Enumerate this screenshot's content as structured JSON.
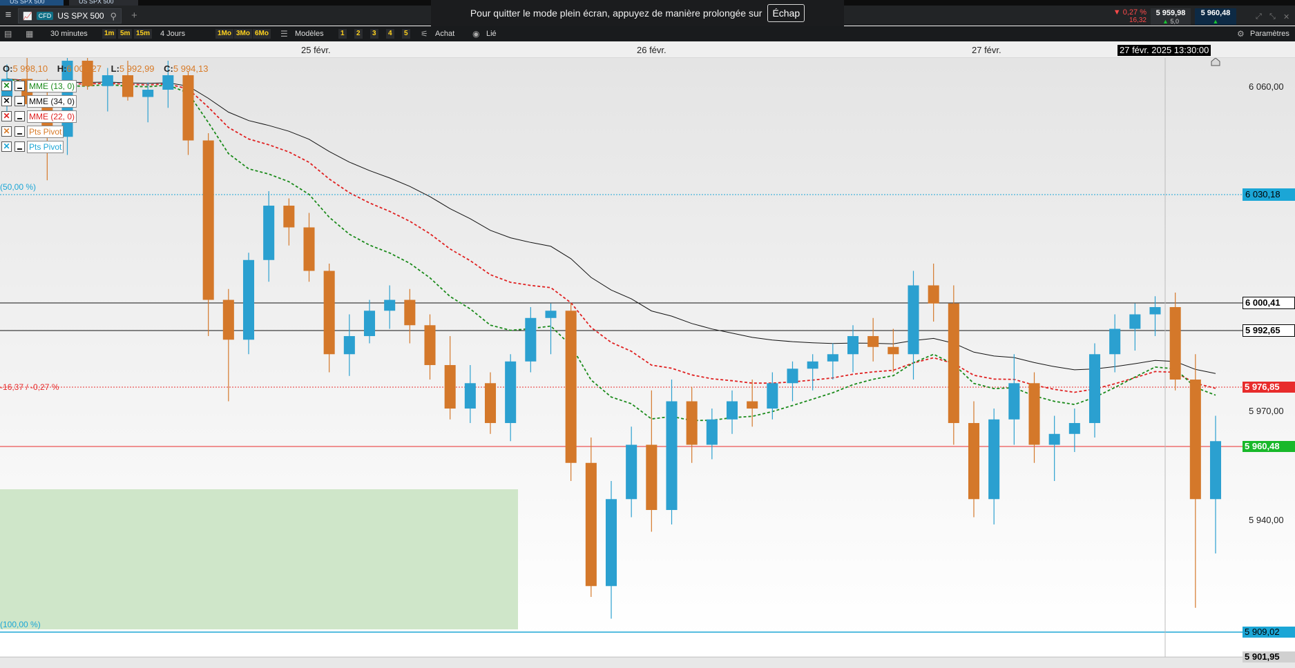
{
  "tabs": [
    "US SPX 500",
    "US SPX 500"
  ],
  "instrument": {
    "badge": "CFD",
    "name": "US SPX 500"
  },
  "fullscreen_notice": {
    "text": "Pour quitter le mode plein écran, appuyez de manière prolongée sur",
    "key": "Échap"
  },
  "quote": {
    "change_pct": "▼ 0,27 %",
    "change_abs": "16,32",
    "bid": "5 959,98",
    "ask": "5 960,48",
    "spread_marker": "▲",
    "spread": "5,0",
    "ask_marker": "▲"
  },
  "toolbar": {
    "timeframe": "30 minutes",
    "quick_intervals": [
      "1m",
      "5m",
      "15m"
    ],
    "period": "4 Jours",
    "quick_periods": [
      "1Mo",
      "3Mo",
      "6Mo"
    ],
    "templates": "Modèles",
    "layouts": [
      "1",
      "2",
      "3",
      "4",
      "5"
    ],
    "buy": "Achat",
    "linked": "Lié",
    "settings": "Paramètres"
  },
  "dates": [
    "25 févr.",
    "26 févr.",
    "27 févr."
  ],
  "crosshair_time": "27 févr. 2025 13:30:00",
  "ohlc": {
    "o_label": "O:",
    "o": "5 998,10",
    "h_label": "H:",
    "h": "6 002,27",
    "l_label": "L:",
    "l": "5 992,99",
    "c_label": "C:",
    "c": "5 994,13"
  },
  "indicators": [
    {
      "label": "MME (13, 0)",
      "color": "#1a8a1a"
    },
    {
      "label": "MME (34, 0)",
      "color": "#111111"
    },
    {
      "label": "MME (22, 0)",
      "color": "#e02020"
    },
    {
      "label": "Pts Pivot",
      "color": "#d87b28"
    },
    {
      "label": "Pts Pivot",
      "color": "#1ba6d6"
    }
  ],
  "fibo_levels": [
    "(50,00 %)",
    "(100,00 %)"
  ],
  "change_line_label": "-16,37 / -0,27 %",
  "price_axis": {
    "ticks": [
      "6 060,00",
      "5 970,00",
      "5 940,00"
    ],
    "markers": [
      {
        "value": "6 030,18",
        "bg": "#1ba6d6",
        "fg": "#000000"
      },
      {
        "value": "6 000,41",
        "bg": "#ffffff",
        "fg": "#000000"
      },
      {
        "value": "5 992,65",
        "bg": "#ffffff",
        "fg": "#000000"
      },
      {
        "value": "5 976,85",
        "bg": "#e82c2c",
        "fg": "#ffffff"
      },
      {
        "value": "5 960,48",
        "bg": "#18b82a",
        "fg": "#ffffff"
      },
      {
        "value": "5 909,02",
        "bg": "#1ba6d6",
        "fg": "#000000"
      },
      {
        "value": "5 901,95",
        "bg": "#d0d0d0",
        "fg": "#000000"
      }
    ]
  },
  "colors": {
    "up": "#2ba0d0",
    "down": "#d4782a",
    "ema13": "#1a8a1a",
    "ema34": "#111111",
    "ema22": "#e02020",
    "zone": "#cfe6c9"
  },
  "chart_data": {
    "type": "candlestick",
    "time_range": [
      "25 févr.",
      "27 févr. 2025 13:30:00"
    ],
    "candles_ohlc": [
      [
        6056,
        6065,
        6050,
        6061
      ],
      [
        6061,
        6067,
        6056,
        6054
      ],
      [
        6054,
        6061,
        6033,
        6045
      ],
      [
        6045,
        6068,
        6040,
        6066
      ],
      [
        6066,
        6071,
        6058,
        6059
      ],
      [
        6059,
        6064,
        6052,
        6062
      ],
      [
        6062,
        6066,
        6055,
        6056
      ],
      [
        6056,
        6060,
        6049,
        6058
      ],
      [
        6058,
        6066,
        6053,
        6062
      ],
      [
        6062,
        6063,
        6040,
        6044
      ],
      [
        6044,
        6046,
        5990,
        6000
      ],
      [
        6000,
        6003,
        5972,
        5989
      ],
      [
        5989,
        6013,
        5985,
        6011
      ],
      [
        6011,
        6030,
        6005,
        6026
      ],
      [
        6026,
        6028,
        6015,
        6020
      ],
      [
        6020,
        6024,
        6005,
        6008
      ],
      [
        6008,
        6010,
        5980,
        5985
      ],
      [
        5985,
        5996,
        5979,
        5990
      ],
      [
        5990,
        6000,
        5988,
        5997
      ],
      [
        5997,
        6004,
        5992,
        6000
      ],
      [
        6000,
        6003,
        5988,
        5993
      ],
      [
        5993,
        5996,
        5978,
        5982
      ],
      [
        5982,
        5990,
        5967,
        5970
      ],
      [
        5970,
        5982,
        5966,
        5977
      ],
      [
        5977,
        5980,
        5963,
        5966
      ],
      [
        5966,
        5985,
        5961,
        5983
      ],
      [
        5983,
        5998,
        5980,
        5995
      ],
      [
        5995,
        5999,
        5985,
        5997
      ],
      [
        5997,
        5999,
        5950,
        5955
      ],
      [
        5955,
        5962,
        5918,
        5921
      ],
      [
        5921,
        5950,
        5912,
        5945
      ],
      [
        5945,
        5965,
        5940,
        5960
      ],
      [
        5960,
        5975,
        5936,
        5942
      ],
      [
        5942,
        5978,
        5938,
        5972
      ],
      [
        5972,
        5976,
        5955,
        5960
      ],
      [
        5960,
        5970,
        5956,
        5967
      ],
      [
        5967,
        5975,
        5963,
        5972
      ],
      [
        5972,
        5978,
        5965,
        5970
      ],
      [
        5970,
        5980,
        5967,
        5977
      ],
      [
        5977,
        5983,
        5972,
        5981
      ],
      [
        5981,
        5985,
        5975,
        5983
      ],
      [
        5983,
        5988,
        5978,
        5985
      ],
      [
        5985,
        5993,
        5980,
        5990
      ],
      [
        5990,
        5995,
        5983,
        5987
      ],
      [
        5987,
        5992,
        5980,
        5985
      ],
      [
        5985,
        6008,
        5978,
        6004
      ],
      [
        6004,
        6010,
        5994,
        5999
      ],
      [
        5999,
        6004,
        5960,
        5966
      ],
      [
        5966,
        5972,
        5940,
        5945
      ],
      [
        5945,
        5970,
        5938,
        5967
      ],
      [
        5967,
        5985,
        5960,
        5977
      ],
      [
        5977,
        5980,
        5955,
        5960
      ],
      [
        5960,
        5968,
        5950,
        5963
      ],
      [
        5963,
        5970,
        5958,
        5966
      ],
      [
        5966,
        5988,
        5962,
        5985
      ],
      [
        5985,
        5996,
        5980,
        5992
      ],
      [
        5992,
        5999,
        5986,
        5996
      ],
      [
        5996,
        6001,
        5990,
        5998
      ],
      [
        5998,
        6002,
        5975,
        5978
      ],
      [
        5978,
        5985,
        5915,
        5945
      ],
      [
        5945,
        5968,
        5930,
        5961
      ]
    ]
  }
}
